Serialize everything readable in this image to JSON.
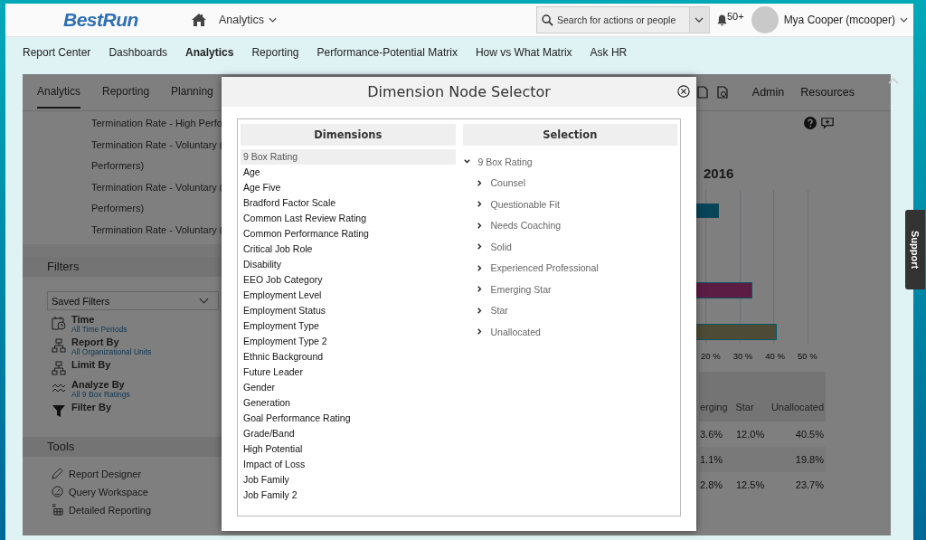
{
  "header": {
    "logo": "BestRun",
    "module": "Analytics",
    "search": {
      "placeholder": "Search for actions or people"
    },
    "notifications": "50+",
    "user": "Mya Cooper (mcooper)"
  },
  "nav": [
    {
      "label": "Report Center",
      "selected": false
    },
    {
      "label": "Dashboards",
      "selected": false
    },
    {
      "label": "Analytics",
      "selected": true
    },
    {
      "label": "Reporting",
      "selected": false
    },
    {
      "label": "Performance-Potential Matrix",
      "selected": false
    },
    {
      "label": "How vs What Matrix",
      "selected": false
    },
    {
      "label": "Ask HR",
      "selected": false
    }
  ],
  "app": {
    "tabs": [
      {
        "label": "Analytics",
        "selected": true
      },
      {
        "label": "Reporting",
        "selected": false
      },
      {
        "label": "Planning",
        "selected": false
      }
    ],
    "right_links": [
      "Admin",
      "Resources"
    ],
    "reports": [
      "Termination Rate - High Perfo",
      "Termination Rate - Voluntary (",
      "Performers)",
      "Termination Rate - Voluntary (",
      "Performers)",
      "Termination Rate - Voluntary ("
    ],
    "filters": {
      "title": "Filters",
      "saved": "Saved Filters",
      "items": [
        {
          "kind": "time",
          "label": "Time",
          "value": "All Time Periods"
        },
        {
          "kind": "org",
          "label": "Report By",
          "value": "All Organizational Units"
        },
        {
          "kind": "org",
          "label": "Limit By"
        },
        {
          "kind": "wave",
          "label": "Analyze By",
          "value": "All 9 Box Ratings"
        },
        {
          "kind": "funnel",
          "label": "Filter By"
        }
      ]
    },
    "tools": {
      "title": "Tools",
      "items": [
        {
          "kind": "pencil",
          "label": "Report Designer"
        },
        {
          "kind": "query",
          "label": "Query Workspace"
        },
        {
          "kind": "grid",
          "label": "Detailed Reporting"
        }
      ]
    },
    "chart_title": "2016",
    "axis_labels": [
      "20 %",
      "30 %",
      "40 %",
      "50 %"
    ],
    "table": {
      "columns": [
        "erging",
        "Star",
        "Unallocated"
      ],
      "rows": [
        [
          "3.6%",
          "12.0%",
          "40.5%"
        ],
        [
          "1.1%",
          null,
          "19.8%"
        ],
        [
          "2.8%",
          "12.5%",
          "23.7%"
        ]
      ]
    }
  },
  "dialog": {
    "title": "Dimension Node Selector",
    "dimensions": {
      "header": "Dimensions",
      "items": [
        {
          "label": "9 Box Rating",
          "selected": true
        },
        {
          "label": "Age",
          "selected": false
        },
        {
          "label": "Age Five",
          "selected": false
        },
        {
          "label": "Bradford Factor Scale",
          "selected": false
        },
        {
          "label": "Common Last Review Rating",
          "selected": false
        },
        {
          "label": "Common Performance Rating",
          "selected": false
        },
        {
          "label": "Critical Job Role",
          "selected": false
        },
        {
          "label": "Disability",
          "selected": false
        },
        {
          "label": "EEO Job Category",
          "selected": false
        },
        {
          "label": "Employment Level",
          "selected": false
        },
        {
          "label": "Employment Status",
          "selected": false
        },
        {
          "label": "Employment Type",
          "selected": false
        },
        {
          "label": "Employment Type 2",
          "selected": false
        },
        {
          "label": "Ethnic Background",
          "selected": false
        },
        {
          "label": "Future Leader",
          "selected": false
        },
        {
          "label": "Gender",
          "selected": false
        },
        {
          "label": "Generation",
          "selected": false
        },
        {
          "label": "Goal Performance Rating",
          "selected": false
        },
        {
          "label": "Grade/Band",
          "selected": false
        },
        {
          "label": "High Potential",
          "selected": false
        },
        {
          "label": "Impact of Loss",
          "selected": false
        },
        {
          "label": "Job Family",
          "selected": false
        },
        {
          "label": "Job Family 2",
          "selected": false
        }
      ]
    },
    "selection": {
      "header": "Selection",
      "tree": {
        "label": "9 Box Rating",
        "expanded": true,
        "children": [
          {
            "label": "Counsel",
            "expanded": false
          },
          {
            "label": "Questionable Fit",
            "expanded": false
          },
          {
            "label": "Needs Coaching",
            "expanded": false
          },
          {
            "label": "Solid",
            "expanded": false
          },
          {
            "label": "Experienced Professional",
            "expanded": false
          },
          {
            "label": "Emerging Star",
            "expanded": false
          },
          {
            "label": "Star",
            "expanded": false
          },
          {
            "label": "Unallocated",
            "expanded": false
          }
        ]
      }
    }
  },
  "support": "Support"
}
